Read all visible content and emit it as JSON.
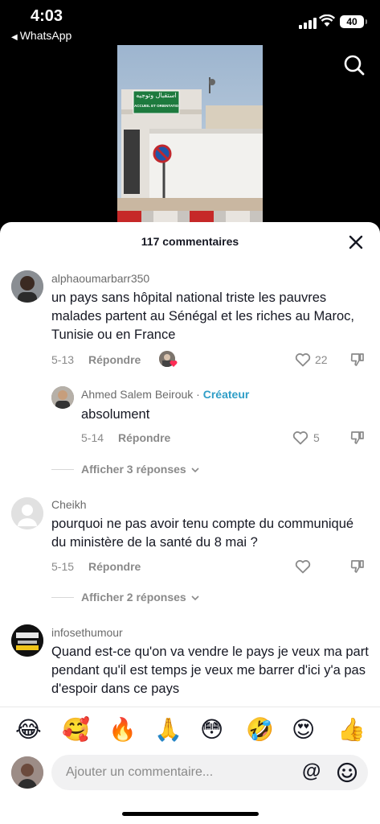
{
  "status_bar": {
    "time": "4:03",
    "back_app": "WhatsApp",
    "battery": "40"
  },
  "video": {
    "sign_arabic": "استقبال وتوجيه",
    "sign_french": "ACCUEIL ET ORIENTATION"
  },
  "comments_sheet": {
    "title": "117 commentaires",
    "comments": [
      {
        "username": "alphaoumarbarr350",
        "text": "un pays sans hôpital national triste les pauvres malades partent au Sénégal et les riches au Maroc, Tunisie ou en France",
        "date": "5-13",
        "reply_label": "Répondre",
        "likes": "22"
      },
      {
        "username": "Ahmed Salem Beirouk",
        "separator": " · ",
        "badge": "Créateur",
        "text": "absolument",
        "date": "5-14",
        "reply_label": "Répondre",
        "likes": "5"
      },
      {
        "username": "Cheikh",
        "text": "pourquoi ne pas avoir tenu compte du communiqué du ministère de la santé du 8 mai ?",
        "date": "5-15",
        "reply_label": "Répondre"
      },
      {
        "username": "infosethumour",
        "text": "Quand est-ce qu'on va vendre le pays je veux ma part pendant qu'il est temps je veux me barrer d'ici y'a pas d'espoir dans ce pays"
      }
    ],
    "show_replies_1": "Afficher 3 réponses",
    "show_replies_2": "Afficher 2 réponses"
  },
  "emoji_bar": [
    "😂",
    "🥰",
    "🔥",
    "🙏",
    "😳",
    "🤣",
    "😍",
    "👍"
  ],
  "comment_input": {
    "placeholder": "Ajouter un commentaire...",
    "mention": "@"
  },
  "colors": {
    "creator": "#2f9ec7",
    "muted": "#8a8a8a",
    "sign_green": "#1d7a3e"
  },
  "icons": [
    "search-icon",
    "close-icon",
    "heart-icon",
    "dislike-icon",
    "chevron-down-icon",
    "smile-icon"
  ]
}
